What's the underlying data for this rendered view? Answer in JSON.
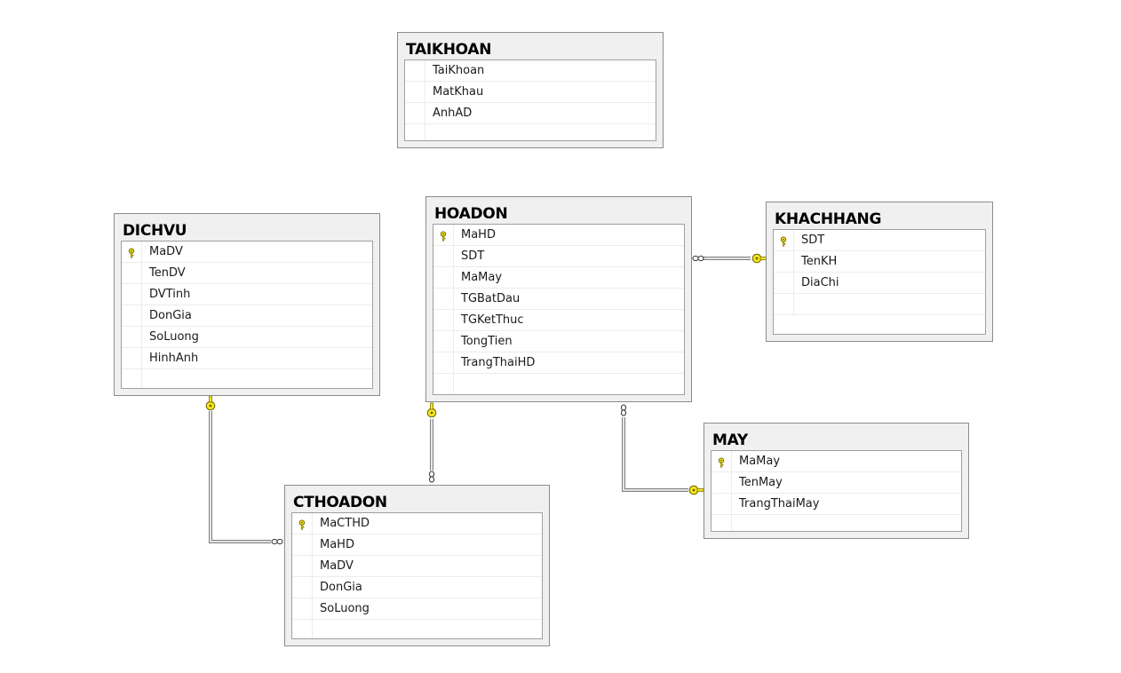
{
  "tables": [
    {
      "name": "TAIKHOAN",
      "columns": [
        {
          "name": "TaiKhoan",
          "pk": false
        },
        {
          "name": "MatKhau",
          "pk": false
        },
        {
          "name": "AnhAD",
          "pk": false
        }
      ]
    },
    {
      "name": "HOADON",
      "columns": [
        {
          "name": "MaHD",
          "pk": true
        },
        {
          "name": "SDT",
          "pk": false
        },
        {
          "name": "MaMay",
          "pk": false
        },
        {
          "name": "TGBatDau",
          "pk": false
        },
        {
          "name": "TGKetThuc",
          "pk": false
        },
        {
          "name": "TongTien",
          "pk": false
        },
        {
          "name": "TrangThaiHD",
          "pk": false
        }
      ]
    },
    {
      "name": "KHACHHANG",
      "columns": [
        {
          "name": "SDT",
          "pk": true
        },
        {
          "name": "TenKH",
          "pk": false
        },
        {
          "name": "DiaChi",
          "pk": false
        }
      ]
    },
    {
      "name": "DICHVU",
      "columns": [
        {
          "name": "MaDV",
          "pk": true
        },
        {
          "name": "TenDV",
          "pk": false
        },
        {
          "name": "DVTinh",
          "pk": false
        },
        {
          "name": "DonGia",
          "pk": false
        },
        {
          "name": "SoLuong",
          "pk": false
        },
        {
          "name": "HinhAnh",
          "pk": false
        }
      ]
    },
    {
      "name": "CTHOADON",
      "columns": [
        {
          "name": "MaCTHD",
          "pk": true
        },
        {
          "name": "MaHD",
          "pk": false
        },
        {
          "name": "MaDV",
          "pk": false
        },
        {
          "name": "DonGia",
          "pk": false
        },
        {
          "name": "SoLuong",
          "pk": false
        }
      ]
    },
    {
      "name": "MAY",
      "columns": [
        {
          "name": "MaMay",
          "pk": true
        },
        {
          "name": "TenMay",
          "pk": false
        },
        {
          "name": "TrangThaiMay",
          "pk": false
        }
      ]
    }
  ],
  "relationships": [
    {
      "from_table": "HOADON",
      "to_table": "KHACHHANG",
      "many_side": "HOADON",
      "one_side": "KHACHHANG"
    },
    {
      "from_table": "HOADON",
      "to_table": "MAY",
      "many_side": "HOADON",
      "one_side": "MAY"
    },
    {
      "from_table": "CTHOADON",
      "to_table": "HOADON",
      "many_side": "CTHOADON",
      "one_side": "HOADON"
    },
    {
      "from_table": "CTHOADON",
      "to_table": "DICHVU",
      "many_side": "CTHOADON",
      "one_side": "DICHVU"
    }
  ],
  "icons": {
    "primary_key": "key-icon",
    "one_end": "key-icon",
    "many_end": "infinity-icon"
  },
  "colors": {
    "key_fill": "#f5e61a",
    "key_stroke": "#6b6200",
    "connector": "#808080",
    "table_bg": "#f0f0f0",
    "grid_bg": "#ffffff"
  }
}
